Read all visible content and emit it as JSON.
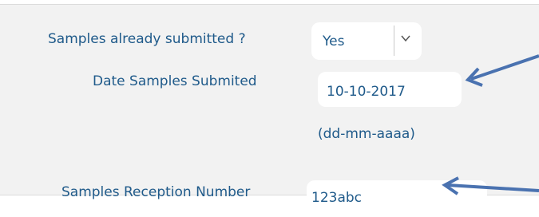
{
  "form": {
    "samples_submitted": {
      "label": "Samples already submitted ?",
      "value": "Yes"
    },
    "date_submitted": {
      "label": "Date Samples Submited",
      "value": "10-10-2017",
      "hint": "(dd-mm-aaaa)"
    },
    "reception_number": {
      "label": "Samples Reception Number",
      "value": "123abc"
    }
  },
  "colors": {
    "label_text": "#1f5a8a",
    "arrow": "#4a72b0",
    "panel_bg": "#f2f2f2"
  },
  "icons": {
    "dropdown": "chevron-down-icon",
    "annotation_arrows": "arrow-left-icon"
  }
}
